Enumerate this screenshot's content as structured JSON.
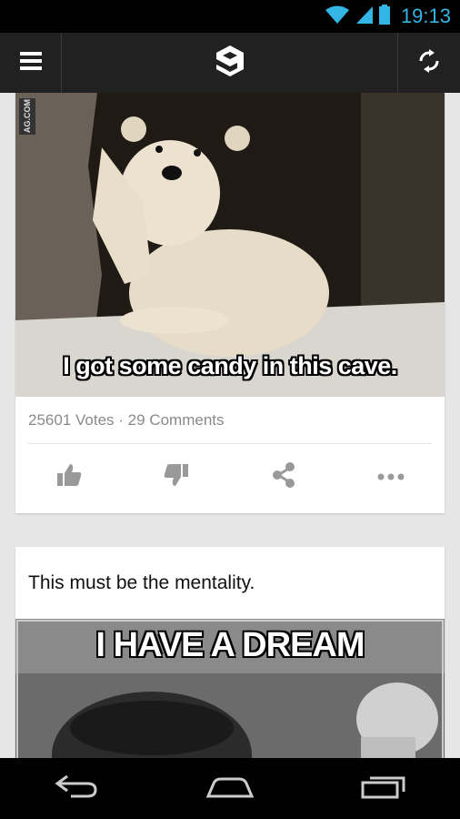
{
  "status_bar": {
    "time": "19:13"
  },
  "app_bar": {
    "menu_icon": "hamburger-menu-icon",
    "logo_icon": "9gag-logo-icon",
    "refresh_icon": "refresh-icon"
  },
  "posts": [
    {
      "image_caption": "I got some candy in this cave.",
      "watermark": "AG.COM",
      "votes": "25601 Votes",
      "separator": "·",
      "comments": "29 Comments",
      "actions": [
        "thumbs-up-icon",
        "thumbs-down-icon",
        "share-icon",
        "more-icon"
      ]
    },
    {
      "title": "This must be the mentality.",
      "image_caption": "I HAVE A DREAM"
    }
  ],
  "nav_bar": {
    "buttons": [
      "back-icon",
      "home-icon",
      "recent-apps-icon"
    ]
  },
  "colors": {
    "accent": "#33b5e5",
    "toolbar": "#212121",
    "background": "#e6e6e6"
  }
}
